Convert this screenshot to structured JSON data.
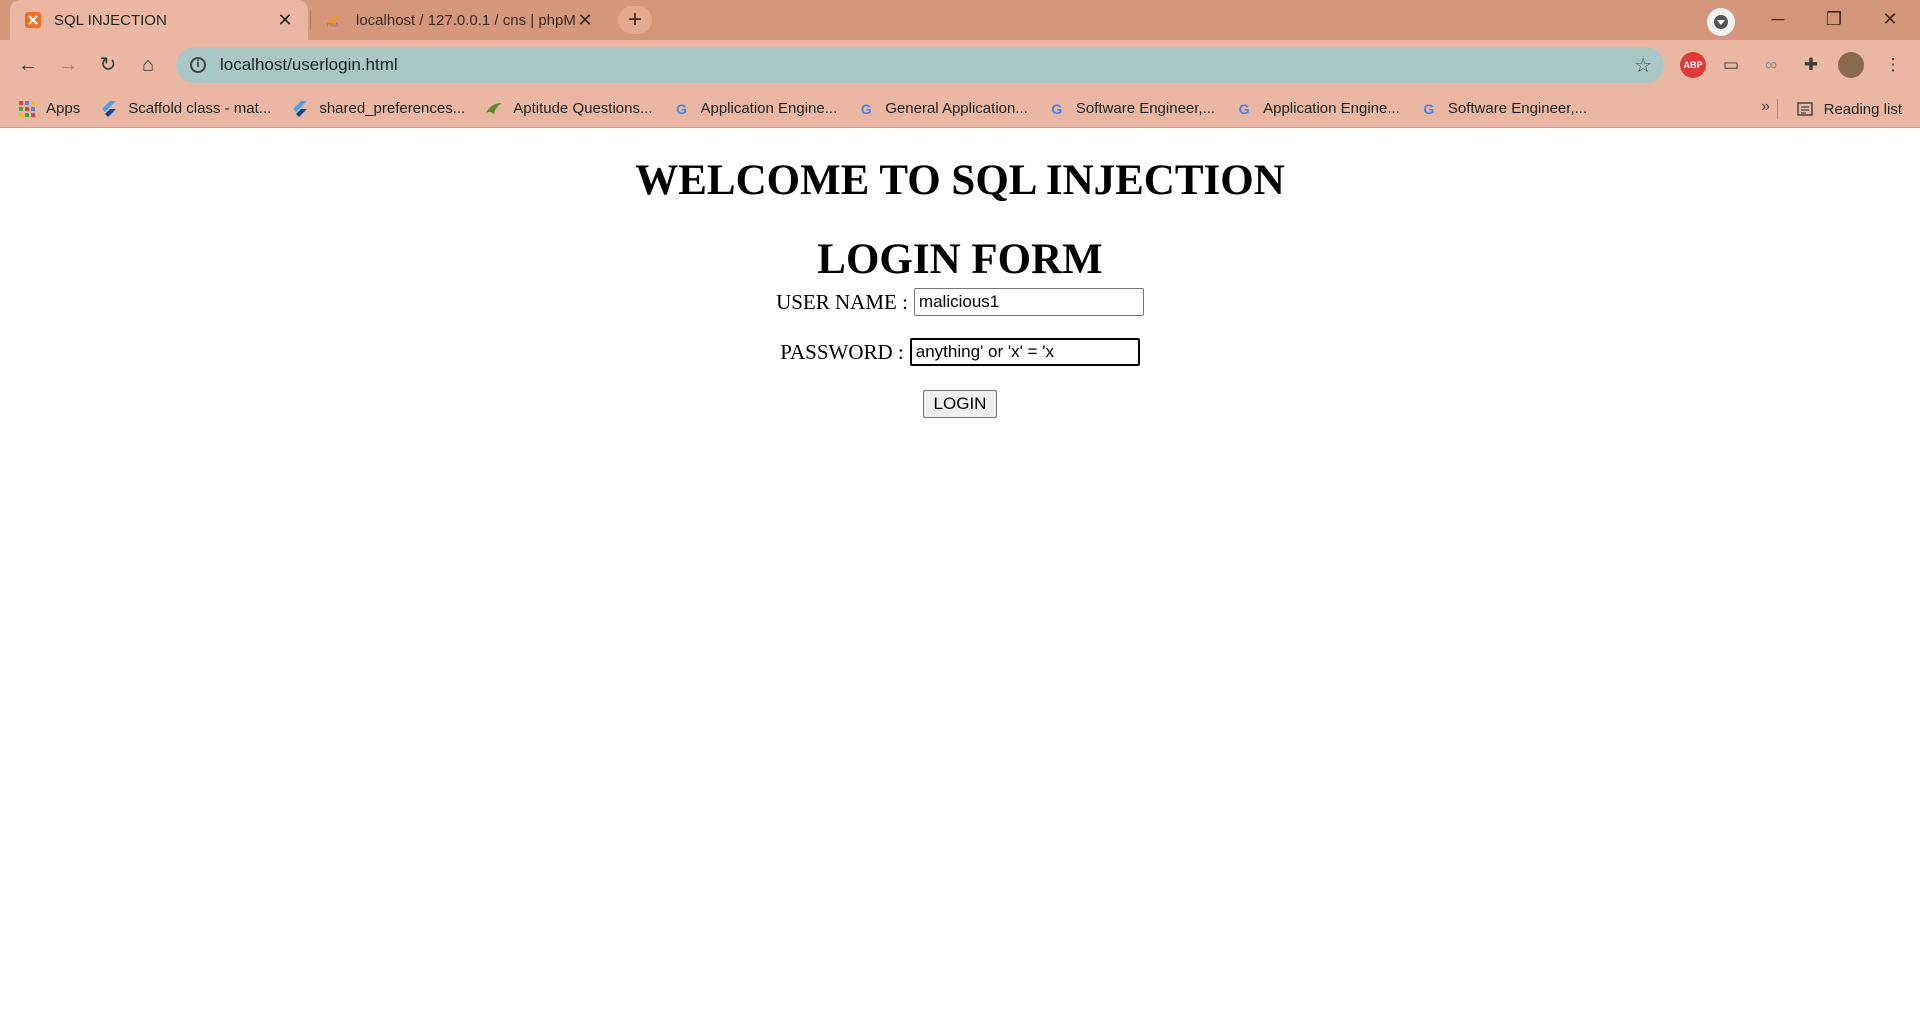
{
  "browser": {
    "tabs": [
      {
        "title": "SQL INJECTION",
        "active": true,
        "favicon": "xampp-icon"
      },
      {
        "title": "localhost / 127.0.0.1 / cns | phpM",
        "active": false,
        "favicon": "phpmyadmin-icon"
      }
    ],
    "address": "localhost/userlogin.html",
    "bookmarks": [
      {
        "label": "Apps",
        "icon": "apps-grid-icon"
      },
      {
        "label": "Scaffold class - mat...",
        "icon": "flutter-icon"
      },
      {
        "label": "shared_preferences...",
        "icon": "flutter-icon"
      },
      {
        "label": "Aptitude Questions...",
        "icon": "bird-icon"
      },
      {
        "label": "Application Engine...",
        "icon": "google-icon"
      },
      {
        "label": "General Application...",
        "icon": "google-icon"
      },
      {
        "label": "Software Engineer,...",
        "icon": "google-icon"
      },
      {
        "label": "Application Engine...",
        "icon": "google-icon"
      },
      {
        "label": "Software Engineer,...",
        "icon": "google-icon"
      }
    ],
    "reading_list": "Reading list",
    "colors": {
      "frame": "#d4977b",
      "toolbar": "#eab8a2",
      "omnibox": "#a9c7c4"
    }
  },
  "page": {
    "heading": "WELCOME TO SQL INJECTION",
    "subheading": "LOGIN FORM",
    "username_label": "USER NAME :",
    "username_value": "malicious1",
    "password_label": "PASSWORD :",
    "password_value": "anything' or 'x' = 'x",
    "login_button": "LOGIN"
  }
}
